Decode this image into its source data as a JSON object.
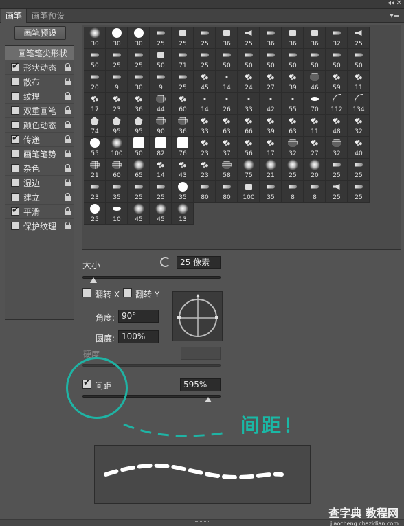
{
  "window": {
    "collapse_icon": "double-chevron-icon",
    "close_icon": "close-icon",
    "menu_icon": "panel-menu-icon"
  },
  "tabs": [
    {
      "label": "画笔",
      "active": true
    },
    {
      "label": "画笔预设",
      "active": false
    }
  ],
  "presets_button": "画笔预设",
  "options": [
    {
      "label": "画笔笔尖形状",
      "checked": null,
      "lock": false,
      "header": true
    },
    {
      "label": "形状动态",
      "checked": true,
      "lock": true
    },
    {
      "label": "散布",
      "checked": false,
      "lock": true
    },
    {
      "label": "纹理",
      "checked": false,
      "lock": true
    },
    {
      "label": "双重画笔",
      "checked": false,
      "lock": true
    },
    {
      "label": "颜色动态",
      "checked": false,
      "lock": true
    },
    {
      "label": "传递",
      "checked": true,
      "lock": true
    },
    {
      "label": "画笔笔势",
      "checked": false,
      "lock": true
    },
    {
      "label": "杂色",
      "checked": false,
      "lock": true
    },
    {
      "label": "湿边",
      "checked": false,
      "lock": true
    },
    {
      "label": "建立",
      "checked": false,
      "lock": true
    },
    {
      "label": "平滑",
      "checked": true,
      "lock": true
    },
    {
      "label": "保护纹理",
      "checked": false,
      "lock": true
    }
  ],
  "brushes": [
    {
      "n": "30",
      "s": "soft"
    },
    {
      "n": "30",
      "s": "round"
    },
    {
      "n": "30",
      "s": "round"
    },
    {
      "n": "25",
      "s": "tip"
    },
    {
      "n": "25",
      "s": "flat"
    },
    {
      "n": "25",
      "s": "tip"
    },
    {
      "n": "36",
      "s": "flat"
    },
    {
      "n": "25",
      "s": "speaker"
    },
    {
      "n": "36",
      "s": "tip"
    },
    {
      "n": "36",
      "s": "flat"
    },
    {
      "n": "36",
      "s": "flat"
    },
    {
      "n": "32",
      "s": "tip"
    },
    {
      "n": "25",
      "s": "speaker"
    },
    {
      "n": "50",
      "s": "tip"
    },
    {
      "n": "25",
      "s": "tip"
    },
    {
      "n": "25",
      "s": "tip"
    },
    {
      "n": "50",
      "s": "flat"
    },
    {
      "n": "71",
      "s": "tip"
    },
    {
      "n": "25",
      "s": "tip"
    },
    {
      "n": "50",
      "s": "tip"
    },
    {
      "n": "50",
      "s": "tip"
    },
    {
      "n": "50",
      "s": "tip"
    },
    {
      "n": "50",
      "s": "tip"
    },
    {
      "n": "50",
      "s": "tip"
    },
    {
      "n": "50",
      "s": "tip"
    },
    {
      "n": "50",
      "s": "tip"
    },
    {
      "n": "20",
      "s": "tip"
    },
    {
      "n": "9",
      "s": "tip"
    },
    {
      "n": "30",
      "s": "tip"
    },
    {
      "n": "9",
      "s": "tip"
    },
    {
      "n": "25",
      "s": "tip"
    },
    {
      "n": "45",
      "s": "splat"
    },
    {
      "n": "14",
      "s": "small"
    },
    {
      "n": "24",
      "s": "splat"
    },
    {
      "n": "27",
      "s": "splat"
    },
    {
      "n": "39",
      "s": "splat"
    },
    {
      "n": "46",
      "s": "dots"
    },
    {
      "n": "59",
      "s": "splat"
    },
    {
      "n": "11",
      "s": "splat"
    },
    {
      "n": "17",
      "s": "splat"
    },
    {
      "n": "23",
      "s": "splat"
    },
    {
      "n": "36",
      "s": "splat"
    },
    {
      "n": "44",
      "s": "dots"
    },
    {
      "n": "60",
      "s": "splat"
    },
    {
      "n": "14",
      "s": "small"
    },
    {
      "n": "26",
      "s": "small"
    },
    {
      "n": "33",
      "s": "small"
    },
    {
      "n": "42",
      "s": "small"
    },
    {
      "n": "55",
      "s": "small"
    },
    {
      "n": "70",
      "s": "ellipse"
    },
    {
      "n": "112",
      "s": "grass"
    },
    {
      "n": "134",
      "s": "grass"
    },
    {
      "n": "74",
      "s": "leaf"
    },
    {
      "n": "95",
      "s": "leaf"
    },
    {
      "n": "95",
      "s": "leaf"
    },
    {
      "n": "90",
      "s": "dots"
    },
    {
      "n": "36",
      "s": "dots"
    },
    {
      "n": "33",
      "s": "splat"
    },
    {
      "n": "63",
      "s": "splat"
    },
    {
      "n": "66",
      "s": "splat"
    },
    {
      "n": "39",
      "s": "splat"
    },
    {
      "n": "63",
      "s": "splat"
    },
    {
      "n": "11",
      "s": "splat"
    },
    {
      "n": "48",
      "s": "splat"
    },
    {
      "n": "32",
      "s": "splat"
    },
    {
      "n": "55",
      "s": "round"
    },
    {
      "n": "100",
      "s": "soft"
    },
    {
      "n": "50",
      "s": "square"
    },
    {
      "n": "82",
      "s": "square"
    },
    {
      "n": "76",
      "s": "square"
    },
    {
      "n": "23",
      "s": "splat"
    },
    {
      "n": "37",
      "s": "splat"
    },
    {
      "n": "56",
      "s": "splat"
    },
    {
      "n": "17",
      "s": "splat"
    },
    {
      "n": "32",
      "s": "dots"
    },
    {
      "n": "27",
      "s": "splat"
    },
    {
      "n": "32",
      "s": "dots"
    },
    {
      "n": "40",
      "s": "splat"
    },
    {
      "n": "21",
      "s": "dots"
    },
    {
      "n": "60",
      "s": "dots"
    },
    {
      "n": "65",
      "s": "soft"
    },
    {
      "n": "14",
      "s": "splat"
    },
    {
      "n": "43",
      "s": "splat"
    },
    {
      "n": "23",
      "s": "splat"
    },
    {
      "n": "58",
      "s": "dots"
    },
    {
      "n": "75",
      "s": "soft"
    },
    {
      "n": "21",
      "s": "soft"
    },
    {
      "n": "25",
      "s": "soft"
    },
    {
      "n": "20",
      "s": "soft"
    },
    {
      "n": "25",
      "s": "tip"
    },
    {
      "n": "25",
      "s": "tip"
    },
    {
      "n": "23",
      "s": "tip"
    },
    {
      "n": "35",
      "s": "tip"
    },
    {
      "n": "25",
      "s": "tip"
    },
    {
      "n": "25",
      "s": "tip"
    },
    {
      "n": "35",
      "s": "round"
    },
    {
      "n": "80",
      "s": "tip"
    },
    {
      "n": "80",
      "s": "tip"
    },
    {
      "n": "100",
      "s": "flat"
    },
    {
      "n": "35",
      "s": "tip"
    },
    {
      "n": "8",
      "s": "tip"
    },
    {
      "n": "8",
      "s": "tip"
    },
    {
      "n": "25",
      "s": "speaker"
    },
    {
      "n": "25",
      "s": "tip"
    },
    {
      "n": "25",
      "s": "round"
    },
    {
      "n": "10",
      "s": "ellipse"
    },
    {
      "n": "45",
      "s": "soft"
    },
    {
      "n": "45",
      "s": "soft"
    },
    {
      "n": "13",
      "s": "soft"
    }
  ],
  "size": {
    "label": "大小",
    "value": "25 像素",
    "slider": 0.08,
    "reset_icon": "reset-icon"
  },
  "flip_x": {
    "label": "翻转 X",
    "checked": false
  },
  "flip_y": {
    "label": "翻转 Y",
    "checked": false
  },
  "angle": {
    "label": "角度:",
    "value": "90°"
  },
  "roundness": {
    "label": "圆度:",
    "value": "100%"
  },
  "hardness": {
    "label": "硬度"
  },
  "spacing": {
    "label": "间距",
    "checked": true,
    "value": "595%",
    "slider": 0.91
  },
  "annotation": {
    "text": "间距！",
    "color": "#1ab8a6"
  },
  "watermark": {
    "main": "查字典 教程网",
    "sub": "jiaocheng.chazidian.com"
  },
  "colors": {
    "accent": "#1fb3a4",
    "panel": "#535353"
  }
}
